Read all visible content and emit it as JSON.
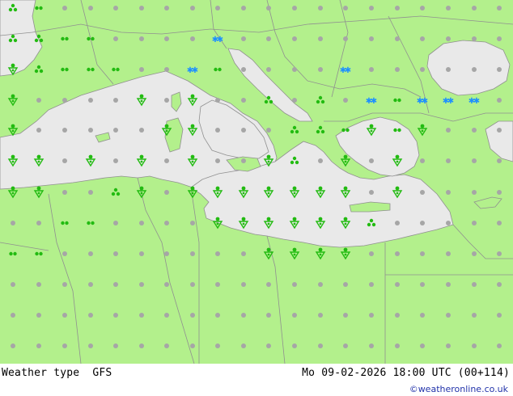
{
  "header": {
    "title_left": "Weather type  GFS",
    "title_right": "Mo 09-02-2026 18:00 UTC (00+114)",
    "credit": "©weatheronline.co.uk"
  },
  "colors": {
    "land": "#b3f08c",
    "sea": "#e9e9e9",
    "border": "#909090",
    "coast": "#909090",
    "dry": "#a6a6a6",
    "rain": "#22bb11",
    "snow": "#1e90ff"
  },
  "icons": {
    "dry": "grey-dot-icon",
    "drizzle": "green-double-dot-icon",
    "showers": "green-triangle-dot-icon",
    "rain_shower": "green-shower-cloud-icon",
    "snow": "blue-snowflake-icon",
    "sleet": "blue-sleet-icon"
  }
}
